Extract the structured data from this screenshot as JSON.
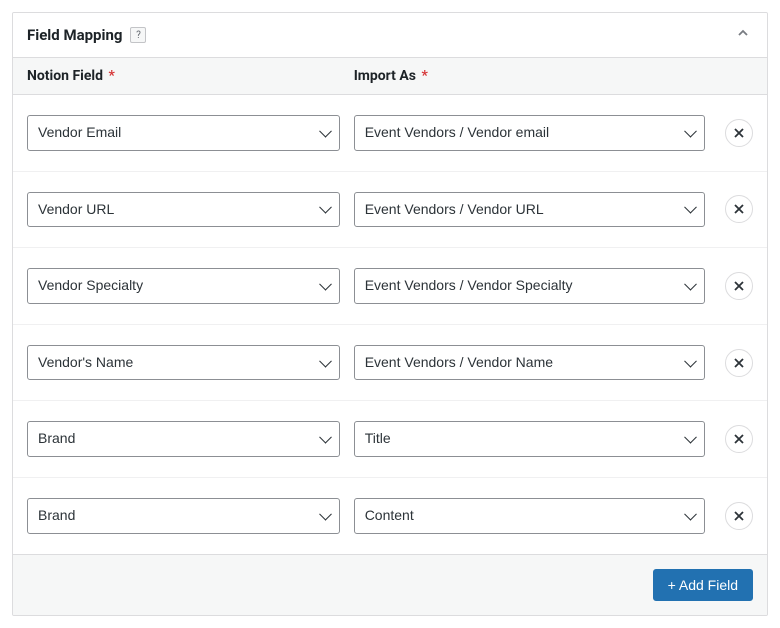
{
  "panel": {
    "title": "Field Mapping",
    "help": "?"
  },
  "columns": {
    "notion": "Notion Field",
    "importAs": "Import As",
    "required": "*"
  },
  "rows": [
    {
      "notion": "Vendor Email",
      "importAs": "Event Vendors / Vendor email"
    },
    {
      "notion": "Vendor URL",
      "importAs": "Event Vendors / Vendor URL"
    },
    {
      "notion": "Vendor Specialty",
      "importAs": "Event Vendors / Vendor Specialty"
    },
    {
      "notion": "Vendor's Name",
      "importAs": "Event Vendors / Vendor Name"
    },
    {
      "notion": "Brand",
      "importAs": "Title"
    },
    {
      "notion": "Brand",
      "importAs": "Content"
    }
  ],
  "footer": {
    "addField": "+ Add Field"
  }
}
